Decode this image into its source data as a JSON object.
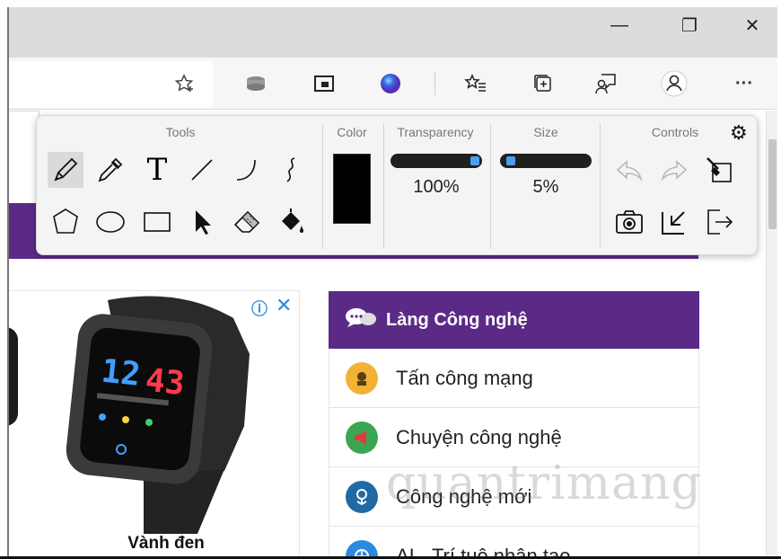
{
  "window": {
    "minimize_glyph": "—",
    "maximize_glyph": "❐",
    "close_glyph": "✕"
  },
  "browser_toolbar": {
    "more_glyph": "···"
  },
  "draw_toolbar": {
    "sections": {
      "tools": "Tools",
      "color": "Color",
      "transparency": "Transparency",
      "size": "Size",
      "controls": "Controls"
    },
    "transparency": {
      "value": 100,
      "label": "100%"
    },
    "size": {
      "value": 5,
      "label": "5%"
    },
    "color": "#000000",
    "text_tool_glyph": "T",
    "tools_row1": [
      "pencil-icon",
      "eyedropper-icon",
      "text-icon",
      "line-icon",
      "curve-icon",
      "squiggle-icon"
    ],
    "tools_row2": [
      "polygon-icon",
      "ellipse-icon",
      "rectangle-icon",
      "pointer-icon",
      "eraser-icon",
      "fill-bucket-icon"
    ],
    "controls": [
      "undo-icon",
      "redo-icon",
      "clear-brush-icon",
      "screenshot-icon",
      "minimize-panel-icon",
      "exit-icon"
    ]
  },
  "ad": {
    "caption": "Vành đen",
    "info_glyph": "ⓘ",
    "close_glyph": "✕",
    "watch_time": "12:43"
  },
  "sidebar": {
    "heading": "Làng Công nghệ",
    "items": [
      {
        "label": "Tấn công mạng",
        "color": "#f2b233"
      },
      {
        "label": "Chuyện công nghệ",
        "color": "#3aa653"
      },
      {
        "label": "Công nghệ mới",
        "color": "#1f6aa5"
      },
      {
        "label": "AI - Trí tuệ nhân tạo",
        "color": "#2a8ae0"
      }
    ]
  },
  "watermark": "quantrimang",
  "colors": {
    "accent_purple": "#5b2a86",
    "slider_knob": "#4a9ff0"
  }
}
